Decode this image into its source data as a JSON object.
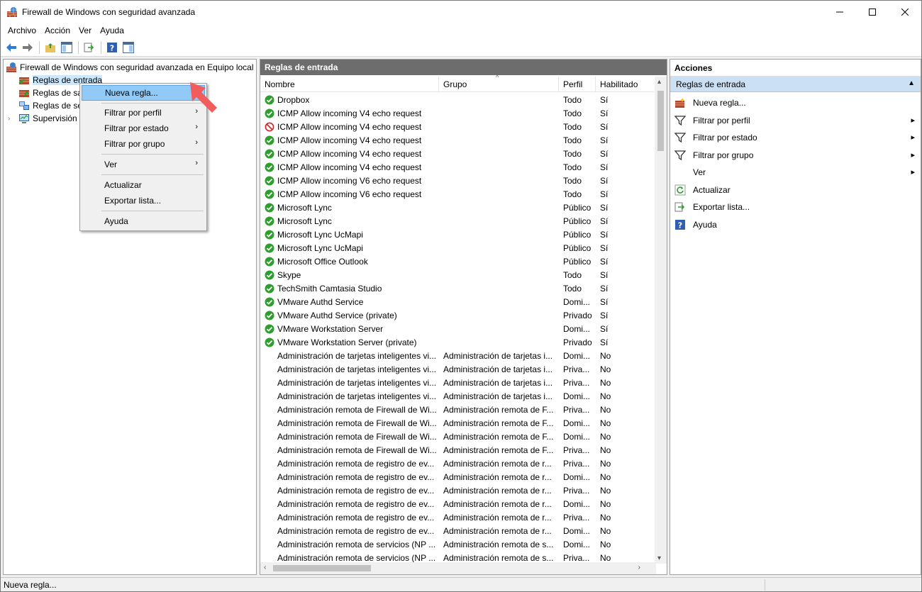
{
  "window": {
    "title": "Firewall de Windows con seguridad avanzada"
  },
  "menubar": {
    "items": [
      "Archivo",
      "Acción",
      "Ver",
      "Ayuda"
    ]
  },
  "tree": {
    "root": "Firewall de Windows con seguridad avanzada en Equipo local",
    "items": [
      "Reglas de entrada",
      "Reglas de sa",
      "Reglas de se",
      "Supervisión"
    ]
  },
  "context_menu": {
    "items": [
      "Nueva regla...",
      "Filtrar por perfil",
      "Filtrar por estado",
      "Filtrar por grupo",
      "Ver",
      "Actualizar",
      "Exportar lista...",
      "Ayuda"
    ]
  },
  "center": {
    "title": "Reglas de entrada",
    "columns": [
      "Nombre",
      "Grupo",
      "Perfil",
      "Habilitado"
    ],
    "rows": [
      {
        "status": "enabled",
        "name": "Dropbox",
        "group": "",
        "profile": "Todo",
        "enabled": "Sí"
      },
      {
        "status": "enabled",
        "name": "ICMP Allow incoming V4 echo request",
        "group": "",
        "profile": "Todo",
        "enabled": "Sí"
      },
      {
        "status": "blocked",
        "name": "ICMP Allow incoming V4 echo request",
        "group": "",
        "profile": "Todo",
        "enabled": "Sí"
      },
      {
        "status": "enabled",
        "name": "ICMP Allow incoming V4 echo request",
        "group": "",
        "profile": "Todo",
        "enabled": "Sí"
      },
      {
        "status": "enabled",
        "name": "ICMP Allow incoming V4 echo request",
        "group": "",
        "profile": "Todo",
        "enabled": "Sí"
      },
      {
        "status": "enabled",
        "name": "ICMP Allow incoming V4 echo request",
        "group": "",
        "profile": "Todo",
        "enabled": "Sí"
      },
      {
        "status": "enabled",
        "name": "ICMP Allow incoming V6 echo request",
        "group": "",
        "profile": "Todo",
        "enabled": "Sí"
      },
      {
        "status": "enabled",
        "name": "ICMP Allow incoming V6 echo request",
        "group": "",
        "profile": "Todo",
        "enabled": "Sí"
      },
      {
        "status": "enabled",
        "name": "Microsoft Lync",
        "group": "",
        "profile": "Público",
        "enabled": "Sí"
      },
      {
        "status": "enabled",
        "name": "Microsoft Lync",
        "group": "",
        "profile": "Público",
        "enabled": "Sí"
      },
      {
        "status": "enabled",
        "name": "Microsoft Lync UcMapi",
        "group": "",
        "profile": "Público",
        "enabled": "Sí"
      },
      {
        "status": "enabled",
        "name": "Microsoft Lync UcMapi",
        "group": "",
        "profile": "Público",
        "enabled": "Sí"
      },
      {
        "status": "enabled",
        "name": "Microsoft Office Outlook",
        "group": "",
        "profile": "Público",
        "enabled": "Sí"
      },
      {
        "status": "enabled",
        "name": "Skype",
        "group": "",
        "profile": "Todo",
        "enabled": "Sí"
      },
      {
        "status": "enabled",
        "name": "TechSmith Camtasia Studio",
        "group": "",
        "profile": "Todo",
        "enabled": "Sí"
      },
      {
        "status": "enabled",
        "name": "VMware Authd Service",
        "group": "",
        "profile": "Domi...",
        "enabled": "Sí"
      },
      {
        "status": "enabled",
        "name": "VMware Authd Service (private)",
        "group": "",
        "profile": "Privado",
        "enabled": "Sí"
      },
      {
        "status": "enabled",
        "name": "VMware Workstation Server",
        "group": "",
        "profile": "Domi...",
        "enabled": "Sí"
      },
      {
        "status": "enabled",
        "name": "VMware Workstation Server (private)",
        "group": "",
        "profile": "Privado",
        "enabled": "Sí"
      },
      {
        "status": "none",
        "name": "Administración de tarjetas inteligentes vi...",
        "group": "Administración de tarjetas i...",
        "profile": "Domi...",
        "enabled": "No"
      },
      {
        "status": "none",
        "name": "Administración de tarjetas inteligentes vi...",
        "group": "Administración de tarjetas i...",
        "profile": "Priva...",
        "enabled": "No"
      },
      {
        "status": "none",
        "name": "Administración de tarjetas inteligentes vi...",
        "group": "Administración de tarjetas i...",
        "profile": "Priva...",
        "enabled": "No"
      },
      {
        "status": "none",
        "name": "Administración de tarjetas inteligentes vi...",
        "group": "Administración de tarjetas i...",
        "profile": "Domi...",
        "enabled": "No"
      },
      {
        "status": "none",
        "name": "Administración remota de Firewall de Wi...",
        "group": "Administración remota de F...",
        "profile": "Priva...",
        "enabled": "No"
      },
      {
        "status": "none",
        "name": "Administración remota de Firewall de Wi...",
        "group": "Administración remota de F...",
        "profile": "Domi...",
        "enabled": "No"
      },
      {
        "status": "none",
        "name": "Administración remota de Firewall de Wi...",
        "group": "Administración remota de F...",
        "profile": "Domi...",
        "enabled": "No"
      },
      {
        "status": "none",
        "name": "Administración remota de Firewall de Wi...",
        "group": "Administración remota de F...",
        "profile": "Priva...",
        "enabled": "No"
      },
      {
        "status": "none",
        "name": "Administración remota de registro de ev...",
        "group": "Administración remota de r...",
        "profile": "Priva...",
        "enabled": "No"
      },
      {
        "status": "none",
        "name": "Administración remota de registro de ev...",
        "group": "Administración remota de r...",
        "profile": "Domi...",
        "enabled": "No"
      },
      {
        "status": "none",
        "name": "Administración remota de registro de ev...",
        "group": "Administración remota de r...",
        "profile": "Priva...",
        "enabled": "No"
      },
      {
        "status": "none",
        "name": "Administración remota de registro de ev...",
        "group": "Administración remota de r...",
        "profile": "Domi...",
        "enabled": "No"
      },
      {
        "status": "none",
        "name": "Administración remota de registro de ev...",
        "group": "Administración remota de r...",
        "profile": "Priva...",
        "enabled": "No"
      },
      {
        "status": "none",
        "name": "Administración remota de registro de ev...",
        "group": "Administración remota de r...",
        "profile": "Domi...",
        "enabled": "No"
      },
      {
        "status": "none",
        "name": "Administración remota de servicios (NP ...",
        "group": "Administración remota de s...",
        "profile": "Domi...",
        "enabled": "No"
      },
      {
        "status": "none",
        "name": "Administración remota de servicios (NP ...",
        "group": "Administración remota de s...",
        "profile": "Priva...",
        "enabled": "No"
      }
    ]
  },
  "actions": {
    "title": "Acciones",
    "section": "Reglas de entrada",
    "items": [
      {
        "label": "Nueva regla...",
        "icon": "new-rule-icon",
        "submenu": false
      },
      {
        "label": "Filtrar por perfil",
        "icon": "filter-icon",
        "submenu": true
      },
      {
        "label": "Filtrar por estado",
        "icon": "filter-icon",
        "submenu": true
      },
      {
        "label": "Filtrar por grupo",
        "icon": "filter-icon",
        "submenu": true
      },
      {
        "label": "Ver",
        "icon": "",
        "submenu": true
      },
      {
        "label": "Actualizar",
        "icon": "refresh-icon",
        "submenu": false
      },
      {
        "label": "Exportar lista...",
        "icon": "export-icon",
        "submenu": false
      },
      {
        "label": "Ayuda",
        "icon": "help-icon",
        "submenu": false
      }
    ]
  },
  "statusbar": {
    "text": "Nueva regla..."
  },
  "colors": {
    "accent": "#91c9f7",
    "pane_header": "#6d6d6d",
    "enabled_green": "#2e9e2e",
    "blocked_red": "#d32020",
    "pointer": "#f25c5c"
  }
}
